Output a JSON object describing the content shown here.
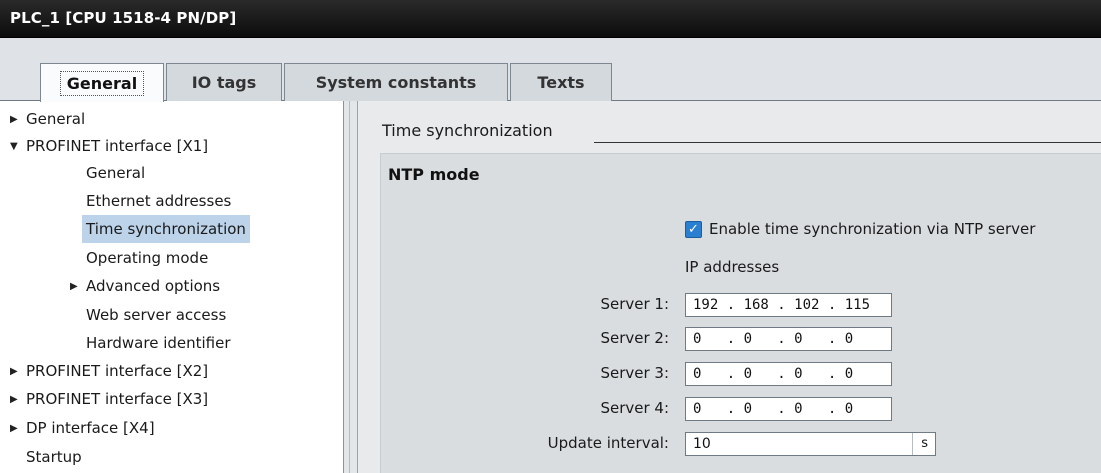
{
  "window": {
    "title": "PLC_1 [CPU 1518-4 PN/DP]"
  },
  "tabs": [
    {
      "label": "General",
      "active": true
    },
    {
      "label": "IO tags",
      "active": false
    },
    {
      "label": "System constants",
      "active": false
    },
    {
      "label": "Texts",
      "active": false
    }
  ],
  "nav": {
    "items": [
      {
        "label": "General",
        "expander": "collapsed",
        "level": 0
      },
      {
        "label": "PROFINET interface [X1]",
        "expander": "expanded",
        "level": 0
      },
      {
        "label": "General",
        "expander": "none",
        "level": 1
      },
      {
        "label": "Ethernet addresses",
        "expander": "none",
        "level": 1
      },
      {
        "label": "Time synchronization",
        "expander": "none",
        "level": 1,
        "selected": true
      },
      {
        "label": "Operating mode",
        "expander": "none",
        "level": 1
      },
      {
        "label": "Advanced options",
        "expander": "collapsed",
        "level": 1
      },
      {
        "label": "Web server access",
        "expander": "none",
        "level": 1
      },
      {
        "label": "Hardware identifier",
        "expander": "none",
        "level": 1
      },
      {
        "label": "PROFINET interface [X2]",
        "expander": "collapsed",
        "level": 0
      },
      {
        "label": "PROFINET interface [X3]",
        "expander": "collapsed",
        "level": 0
      },
      {
        "label": "DP interface [X4]",
        "expander": "collapsed",
        "level": 0
      },
      {
        "label": "Startup",
        "expander": "none",
        "level": 0
      }
    ]
  },
  "content": {
    "section_title": "Time synchronization",
    "panel_title": "NTP mode",
    "enable_ntp": {
      "label": "Enable time synchronization via NTP server",
      "checked": true
    },
    "ip_addresses_label": "IP addresses",
    "servers": [
      {
        "label": "Server 1:",
        "value": "192 . 168 . 102 . 115"
      },
      {
        "label": "Server 2:",
        "value": "0   . 0   . 0   . 0"
      },
      {
        "label": "Server 3:",
        "value": "0   . 0   . 0   . 0"
      },
      {
        "label": "Server 4:",
        "value": "0   . 0   . 0   . 0"
      }
    ],
    "update_interval": {
      "label": "Update interval:",
      "value": "10",
      "unit": "s"
    }
  },
  "colors": {
    "selection": "#bcd3ea",
    "checkbox": "#2a7fd1",
    "titlebar": "#111111"
  }
}
